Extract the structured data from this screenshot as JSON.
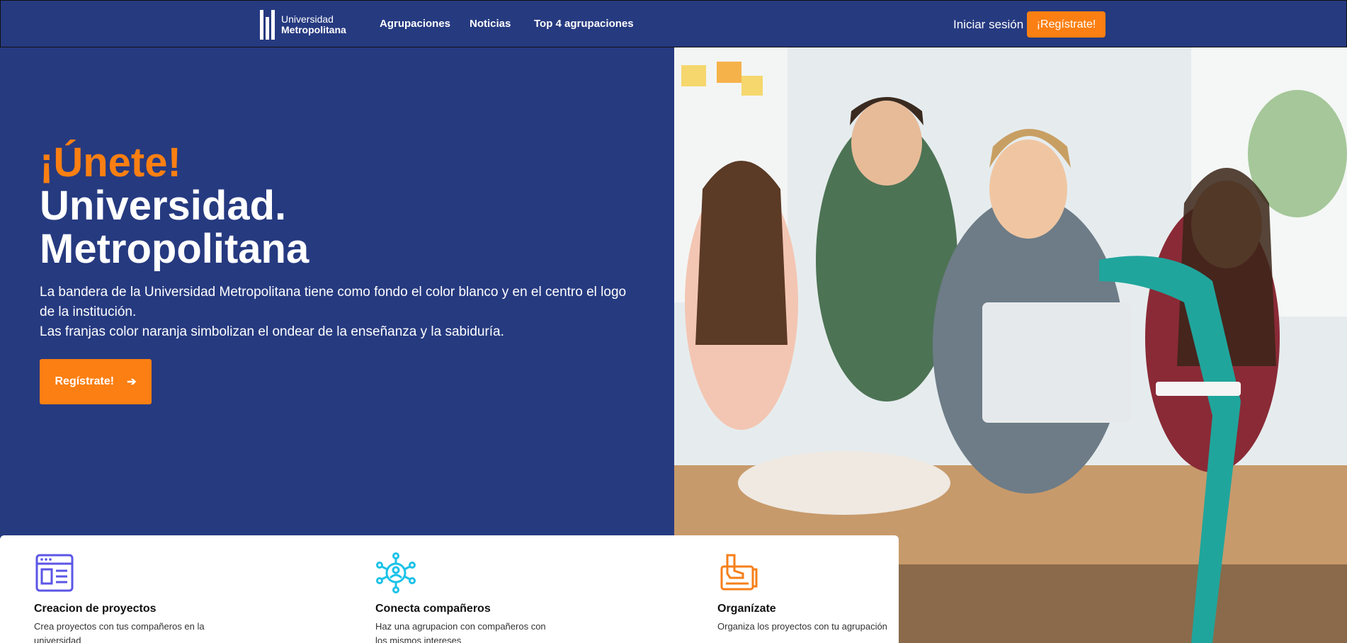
{
  "nav": {
    "logo_line1": "Universidad",
    "logo_line2": "Metropolitana",
    "links": [
      "Agrupaciones",
      "Noticias",
      "Top 4 agrupaciones"
    ],
    "login": "Iniciar sesión",
    "register": "¡Regístrate!"
  },
  "hero": {
    "title_accent": "¡Únete!",
    "title_line2": "Universidad.",
    "title_line3": "Metropolitana",
    "description_line1": "La bandera de la Universidad Metropolitana tiene como fondo el color blanco y en el centro el logo de la institución.",
    "description_line2": "Las franjas color naranja simbolizan el ondear de la enseñanza y la sabiduría.",
    "button": "Regístrate!",
    "button_arrow": "➔"
  },
  "features": [
    {
      "icon": "browser-layout-icon",
      "title": "Creacion de proyectos",
      "description": "Crea proyectos con tus compañeros en la universidad"
    },
    {
      "icon": "network-people-icon",
      "title": "Conecta compañeros",
      "description": "Haz una agrupacion con compañeros con los mismos intereses"
    },
    {
      "icon": "drawing-board-icon",
      "title": "Organízate",
      "description": "Organiza los proyectos con tu agrupación"
    }
  ],
  "colors": {
    "brand_blue": "#263A80",
    "accent_orange": "#FB7F12"
  }
}
